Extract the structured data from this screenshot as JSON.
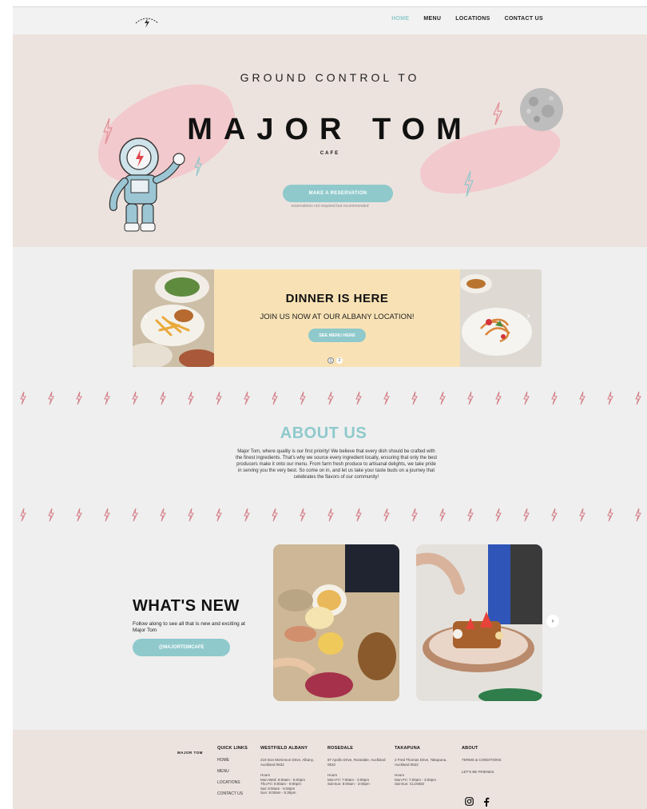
{
  "nav": {
    "items": [
      "HOME",
      "MENU",
      "LOCATIONS",
      "CONTACT US"
    ],
    "active_index": 0
  },
  "hero": {
    "pretitle": "GROUND CONTROL TO",
    "title": "MAJOR TOM",
    "subtitle": "CAFE",
    "button": "MAKE A RESERVATION",
    "note": "reservations not required but recommended"
  },
  "carousel": {
    "title": "DINNER IS HERE",
    "subtitle": "JOIN US NOW AT OUR ALBANY LOCATION!",
    "button": "SEE MENU HERE",
    "dots": [
      "1",
      "2"
    ],
    "prev_icon": "chevron-left-icon",
    "next_icon": "chevron-right-icon"
  },
  "about": {
    "title": "ABOUT US",
    "text": "Major Tom, where quality is our first priority! We believe that every dish should be crafted with the finest ingredients. That's why we source every ingredient locally, ensuring that only the best producers make it onto our menu. From farm fresh produce to artisanal delights, we take pride in serving you the very best. So come on in, and let us take your taste buds on a journey that celebrates the flavors of our community!"
  },
  "whats_new": {
    "title": "WHAT'S NEW",
    "text": "Follow along to see all that is new and exciting at Major Tom",
    "button": "@MAJORTOMCAFE"
  },
  "footer": {
    "brand": "MAJOR TOM",
    "quick_links": {
      "heading": "QUICK LINKS",
      "items": [
        "HOME",
        "MENU",
        "LOCATIONS",
        "CONTACT US"
      ]
    },
    "westfield": {
      "heading": "WESTFIELD ALBANY",
      "address": "219 Don McKinnon Drive, Albany, Auckland 0632",
      "hours_label": "Hours",
      "hours": [
        "Mon-Wed: 8:00am - 5:00pm",
        "Thu-Fri: 8:00am - 9:00pm",
        "Sat: 8:00am - 6:00pm",
        "Sun: 8:00am - 5:30pm"
      ]
    },
    "rosedale": {
      "heading": "ROSEDALE",
      "address": "87 Apollo Drive, Rosedale, Auckland 0632",
      "hours_label": "Hours",
      "hours": [
        "Mon-Fri: 7:00am - 3:00pm",
        "Sat-Sun: 8:00am - 3:00pm"
      ]
    },
    "takapuna": {
      "heading": "TAKAPUNA",
      "address": "2 Fred Thomas Drive, Takapuna, Auckland 0622",
      "hours_label": "Hours",
      "hours": [
        "Mon-Fri: 7:00am - 3:00pm",
        "Sat-Sun: CLOSED"
      ]
    },
    "about": {
      "heading": "ABOUT",
      "items": [
        "TERMS & CONDITIONS",
        "LET'S BE FRIENDS"
      ]
    },
    "social": [
      "instagram-icon",
      "facebook-icon"
    ]
  },
  "colors": {
    "accent": "#8fc9cc",
    "hero_bg": "#ede3de",
    "blob": "#f2c9cc",
    "carousel_bg": "#f8e2b5",
    "bolt": "#d47f88"
  }
}
